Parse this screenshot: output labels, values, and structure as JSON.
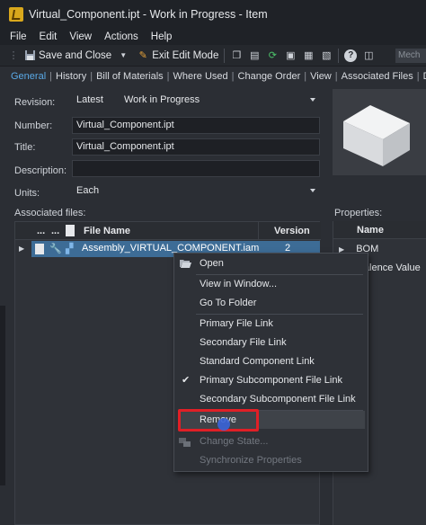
{
  "window": {
    "title": "Virtual_Component.ipt - Work in Progress - Item"
  },
  "menu": [
    "File",
    "Edit",
    "View",
    "Actions",
    "Help"
  ],
  "toolbar": {
    "save_close": "Save and Close",
    "exit_edit": "Exit Edit Mode",
    "search_placeholder": "Mech"
  },
  "tabs": [
    "General",
    "History",
    "Bill of Materials",
    "Where Used",
    "Change Order",
    "View",
    "Associated Files",
    "Da"
  ],
  "form": {
    "revision_label": "Revision:",
    "revision_value": "Latest",
    "revision_state": "Work in Progress",
    "number_label": "Number:",
    "number_value": "Virtual_Component.ipt",
    "title_label": "Title:",
    "title_value": "Virtual_Component.ipt",
    "description_label": "Description:",
    "description_value": "",
    "units_label": "Units:",
    "units_value": "Each"
  },
  "files": {
    "section_label": "Associated files:",
    "col_dots": "...",
    "col_dots2": "...",
    "col_name": "File Name",
    "col_version": "Version",
    "rows": [
      {
        "name": "Assembly_VIRTUAL_COMPONENT.iam",
        "version": "2"
      }
    ]
  },
  "properties": {
    "section_label": "Properties:",
    "col_name": "Name",
    "rows": [
      "BOM",
      "ivalence Value"
    ]
  },
  "context_menu": {
    "open": "Open",
    "view_in_window": "View in Window...",
    "go_to_folder": "Go To Folder",
    "primary_file_link": "Primary File Link",
    "secondary_file_link": "Secondary File Link",
    "standard_component_link": "Standard Component Link",
    "primary_subcomponent_file_link": "Primary Subcomponent File Link",
    "secondary_subcomponent_file_link": "Secondary Subcomponent File Link",
    "remove": "Remove",
    "change_state": "Change State...",
    "synchronize_properties": "Synchronize Properties"
  },
  "colors": {
    "accent": "#5aa9e6",
    "selection": "#3d6c96",
    "highlight_box": "#e01f26"
  }
}
